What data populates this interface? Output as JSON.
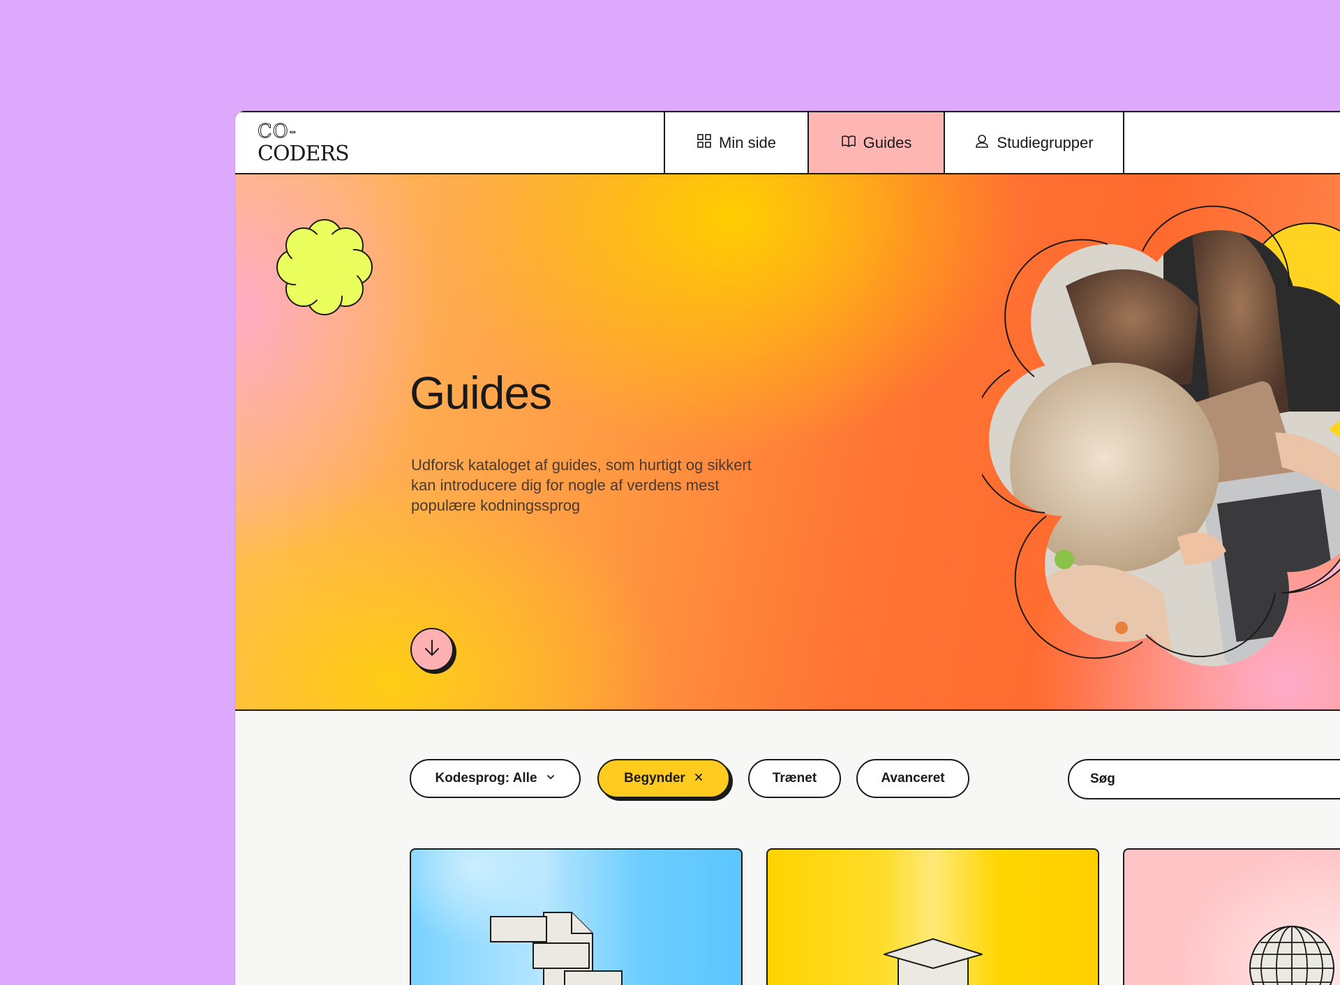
{
  "logo": {
    "line1": "CO-",
    "line2": "CODERS"
  },
  "nav": {
    "items": [
      {
        "label": "Min side",
        "icon": "grid-icon",
        "active": false
      },
      {
        "label": "Guides",
        "icon": "book-icon",
        "active": true
      },
      {
        "label": "Studiegrupper",
        "icon": "user-icon",
        "active": false
      }
    ]
  },
  "hero": {
    "title": "Guides",
    "description": "Udforsk kataloget af guides, som hurtigt og sikkert kan introducere dig for nogle af verdens mest populære kodningssprog"
  },
  "filters": {
    "language": "Kodesprog: Alle",
    "levels": [
      {
        "label": "Begynder",
        "active": true
      },
      {
        "label": "Trænet",
        "active": false
      },
      {
        "label": "Avanceret",
        "active": false
      }
    ],
    "search_placeholder": "Søg"
  },
  "colors": {
    "page_background": "#dda9fc",
    "active_nav": "#ffb5b1",
    "active_filter": "#ffcb1f",
    "accent_yellow_flower": "#eaff5e",
    "card_blue": "#6ccdff",
    "card_yellow": "#ffd400",
    "card_pink": "#ffc4c6"
  }
}
